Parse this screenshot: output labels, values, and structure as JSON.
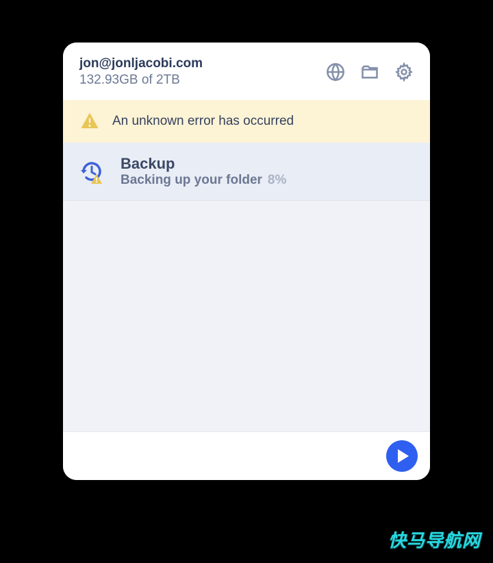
{
  "header": {
    "email": "jon@jonljacobi.com",
    "storage": "132.93GB of 2TB"
  },
  "banner": {
    "message": "An unknown error has occurred"
  },
  "backup": {
    "title": "Backup",
    "status": "Backing up your folder",
    "percent": "8%"
  },
  "watermark": "快马导航网"
}
